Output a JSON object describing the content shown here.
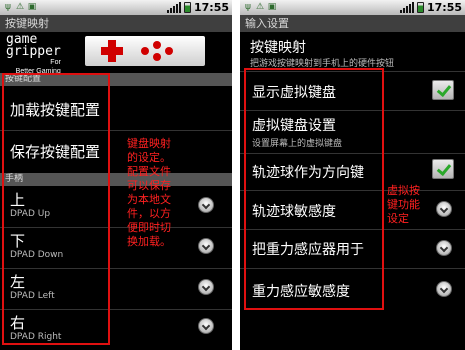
{
  "left": {
    "status": {
      "time": "17:55"
    },
    "title": "按键映射",
    "header": {
      "logo_line1": "game",
      "logo_line2": "gripper",
      "logo_line3": "For",
      "logo_line4": "Better Gaming"
    },
    "section_config": "按键配置",
    "load_config": "加载按键配置",
    "save_config": "保存按键配置",
    "section_gamepad": "手柄",
    "dpad_items": [
      {
        "title": "上",
        "sub": "DPAD Up"
      },
      {
        "title": "下",
        "sub": "DPAD Down"
      },
      {
        "title": "左",
        "sub": "DPAD Left"
      },
      {
        "title": "右",
        "sub": "DPAD Right"
      }
    ],
    "annotation": [
      "键盘映射",
      "的设定。",
      "配置文件",
      "可以保存",
      "为本地文",
      "件，以方",
      "便即时切",
      "换加载。"
    ]
  },
  "right": {
    "status": {
      "time": "17:55"
    },
    "title": "输入设置",
    "key_mapping": {
      "title": "按键映射",
      "sub": "把游戏按键映射到手机上的硬件按钮"
    },
    "show_keyboard": "显示虚拟键盘",
    "keyboard_settings": {
      "title": "虚拟键盘设置",
      "sub": "设置屏幕上的虚拟键盘"
    },
    "trackball_direction": "轨迹球作为方向键",
    "trackball_sensitivity": "轨迹球敏感度",
    "gravity_for": "把重力感应器用于",
    "gravity_sensitivity": "重力感应敏感度",
    "annotation": [
      "虚拟按",
      "键功能",
      "设定"
    ]
  },
  "colors": {
    "annotation": "#ff2020",
    "frame": "#e01010",
    "check": "#2aa82a"
  }
}
